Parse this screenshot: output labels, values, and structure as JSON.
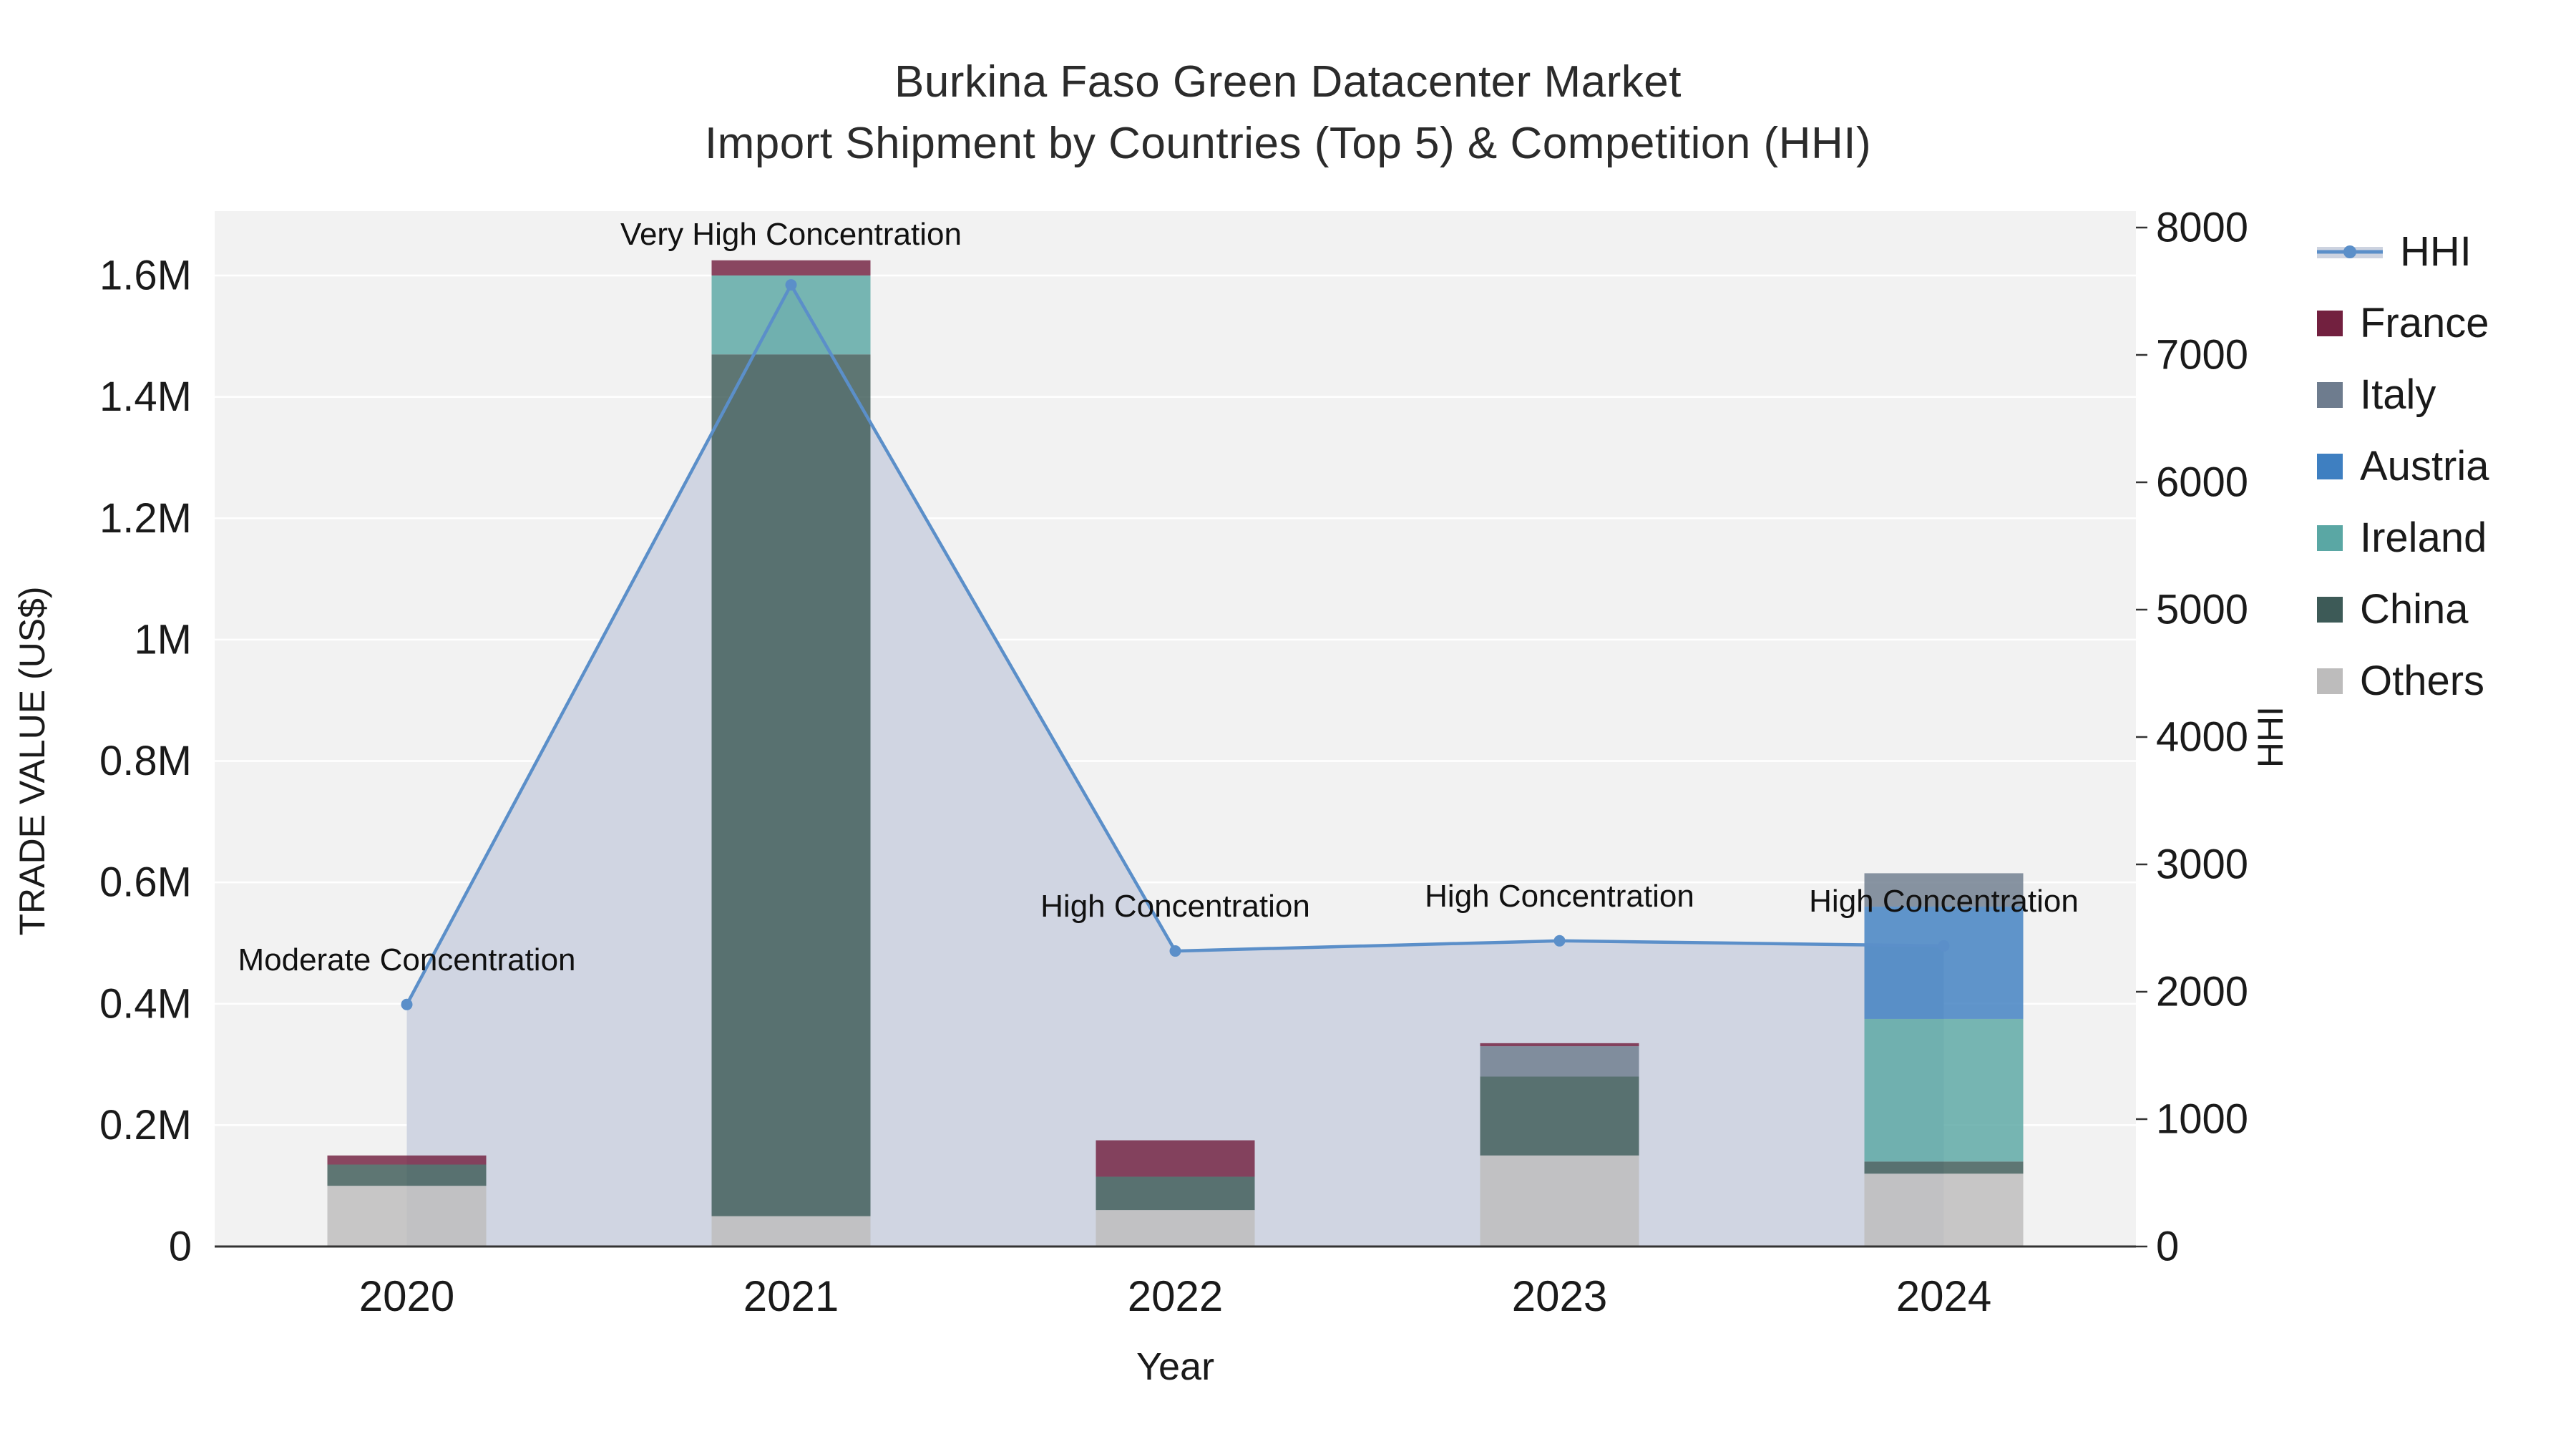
{
  "title": {
    "line1": "Burkina Faso Green Datacenter Market",
    "line2": "Import Shipment by Countries (Top 5) & Competition (HHI)"
  },
  "chart_data": {
    "type": "bar+line",
    "categories": [
      "2020",
      "2021",
      "2022",
      "2023",
      "2024"
    ],
    "x_label": "Year",
    "y_left": {
      "label": "TRADE VALUE (US$)",
      "max": 1600000,
      "ticks": [
        {
          "value": 0,
          "label": "0"
        },
        {
          "value": 200000,
          "label": "0.2M"
        },
        {
          "value": 400000,
          "label": "0.4M"
        },
        {
          "value": 600000,
          "label": "0.6M"
        },
        {
          "value": 800000,
          "label": "0.8M"
        },
        {
          "value": 1000000,
          "label": "1M"
        },
        {
          "value": 1200000,
          "label": "1.2M"
        },
        {
          "value": 1400000,
          "label": "1.4M"
        },
        {
          "value": 1600000,
          "label": "1.6M"
        }
      ]
    },
    "y_right": {
      "label": "HHI",
      "max": 8000,
      "ticks": [
        {
          "value": 0,
          "label": "0"
        },
        {
          "value": 1000,
          "label": "1000"
        },
        {
          "value": 2000,
          "label": "2000"
        },
        {
          "value": 3000,
          "label": "3000"
        },
        {
          "value": 4000,
          "label": "4000"
        },
        {
          "value": 5000,
          "label": "5000"
        },
        {
          "value": 6000,
          "label": "6000"
        },
        {
          "value": 7000,
          "label": "7000"
        },
        {
          "value": 8000,
          "label": "8000"
        }
      ]
    },
    "bar_series": [
      {
        "name": "Others",
        "color": "#bdbcbc",
        "values": [
          100000,
          50000,
          60000,
          150000,
          120000
        ]
      },
      {
        "name": "China",
        "color": "#3d5a57",
        "values": [
          35000,
          1420000,
          55000,
          130000,
          20000
        ]
      },
      {
        "name": "Ireland",
        "color": "#5aa7a4",
        "values": [
          0,
          130000,
          0,
          0,
          235000
        ]
      },
      {
        "name": "Austria",
        "color": "#3e7fc1",
        "values": [
          0,
          0,
          0,
          0,
          185000
        ]
      },
      {
        "name": "Italy",
        "color": "#6e7c8e",
        "values": [
          0,
          0,
          0,
          50000,
          55000
        ]
      },
      {
        "name": "France",
        "color": "#72203f",
        "values": [
          15000,
          25000,
          60000,
          5000,
          0
        ]
      }
    ],
    "line_series": {
      "name": "HHI",
      "color": "#5b8fc9",
      "area_fill": "#cdd3e0",
      "values": [
        1900,
        7550,
        2320,
        2400,
        2360
      ]
    },
    "annotations": [
      {
        "index": 0,
        "text": "Moderate Concentration"
      },
      {
        "index": 1,
        "text": "Very High Concentration"
      },
      {
        "index": 2,
        "text": "High Concentration"
      },
      {
        "index": 3,
        "text": "High Concentration"
      },
      {
        "index": 4,
        "text": "High Concentration"
      }
    ],
    "legend_order": [
      "HHI",
      "France",
      "Italy",
      "Austria",
      "Ireland",
      "China",
      "Others"
    ]
  }
}
